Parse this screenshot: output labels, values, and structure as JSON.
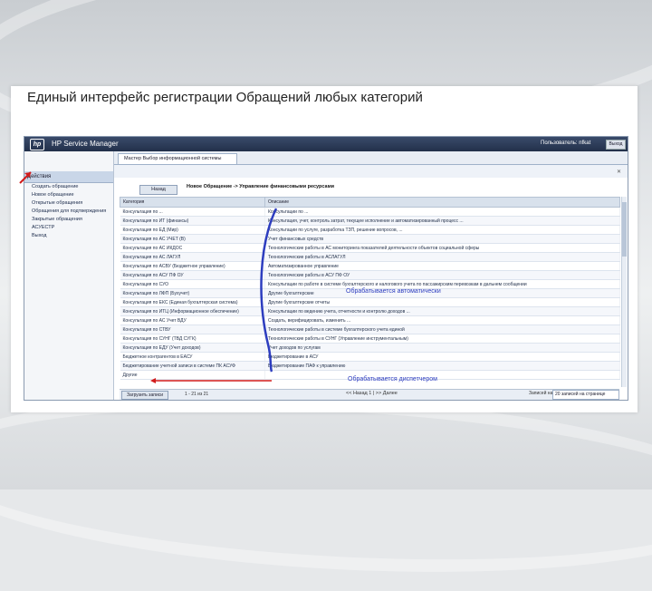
{
  "slide": {
    "title": "Единый интерфейс регистрации Обращений любых категорий"
  },
  "app": {
    "brand": "HP Service Manager",
    "user_label": "Пользователь: nfkat",
    "logout_label": "Выход",
    "tab_label": "Мастер Выбор информационной системы",
    "back_label": "Назад",
    "breadcrumb": "Новое Обращение -> Управление финансовыми ресурсами"
  },
  "sidebar": {
    "header": "Действия",
    "items": [
      {
        "label": "Создать обращение"
      },
      {
        "label": "Новое обращение"
      },
      {
        "label": "Открытые обращения"
      },
      {
        "label": "Обращения для подтверждения"
      },
      {
        "label": "Закрытые обращения"
      },
      {
        "label": "АСУЕСТР"
      },
      {
        "label": "Выход"
      }
    ]
  },
  "grid": {
    "col_category": "Категория",
    "col_description": "Описание",
    "rows": [
      {
        "category": "Консультация по ...",
        "description": "Консультации по ..."
      },
      {
        "category": "Консультация по ИТ (финансы)",
        "description": "Консультация, учет, контроль затрат, текущее исполнение и автоматизированный процесс ..."
      },
      {
        "category": "Консультация по ЕД (Мир)",
        "description": "Консультации по услуге, разработка ТЗП, решение вопросов, ..."
      },
      {
        "category": "Консультация по АС УЧЕТ (В)",
        "description": "Учет финансовых средств"
      },
      {
        "category": "Консультация по АС ИКДОС",
        "description": "Технологические работы в АС мониторинга показателей деятельности объектов социальной сферы"
      },
      {
        "category": "Консультация по АС ЛАГУЛ",
        "description": "Технологические работы в АСЛАГУЛ"
      },
      {
        "category": "Консультация по АСВУ (Бюджетное управление)",
        "description": "Автоматизированное управление"
      },
      {
        "category": "Консультация по АСУ ПФ ОУ",
        "description": "Технологические работы в АСУ ПФ ОУ"
      },
      {
        "category": "Консультация по СУО",
        "description": "Консультации по работе в системе бухгалтерского и налогового учета по пассажирским перевозкам в дальнем сообщении"
      },
      {
        "category": "Консультация по ЛФП (Бухучет)",
        "description": "Другие бухгалтерские"
      },
      {
        "category": "Консультация по ЕКС (Единая бухгалтерская система)",
        "description": "Другие бухгалтерские отчеты"
      },
      {
        "category": "Консультация по ИТЦ (Информационное обеспечение)",
        "description": "Консультации по ведению учета, отчетности и контролю доходов ..."
      },
      {
        "category": "Консультация по АС Учет ВДУ",
        "description": "Создать, верифицировать, изменить ..."
      },
      {
        "category": "Консультация по СТВУ",
        "description": "Технологические работы в системе бухгалтерского учета единой"
      },
      {
        "category": "Консультация по СУНГ (ТВД СУГК)",
        "description": "Технологические работы в СУНГ (Управление инструментальным)"
      },
      {
        "category": "Консультация по ЕДУ (Учет доходов)",
        "description": "Учет доходов по услугам"
      },
      {
        "category": "Бюджетное контрагентов в ЕАСУ",
        "description": "Бюджетирование в АСУ"
      },
      {
        "category": "Бюджетирование учетной записи в системе ПК АСУФ",
        "description": "Бюджетирование ПАФ к управлению"
      },
      {
        "category": "Другие",
        "description": ""
      }
    ]
  },
  "footer": {
    "button_label": "Загрузить записи",
    "count": "1 - 21 из 21",
    "pager": "<< Назад 1 | >> Далее",
    "per_page_label": "Записей на",
    "per_page_value": "20 записей на странице"
  },
  "annotations": {
    "auto_label": "Обрабатывается автоматически",
    "dispatcher_label": "Обрабатывается диспетчером"
  },
  "colors": {
    "annotation": "#2d3dbf",
    "arrow_red": "#d21b1b",
    "header_bar": "#22304a"
  }
}
